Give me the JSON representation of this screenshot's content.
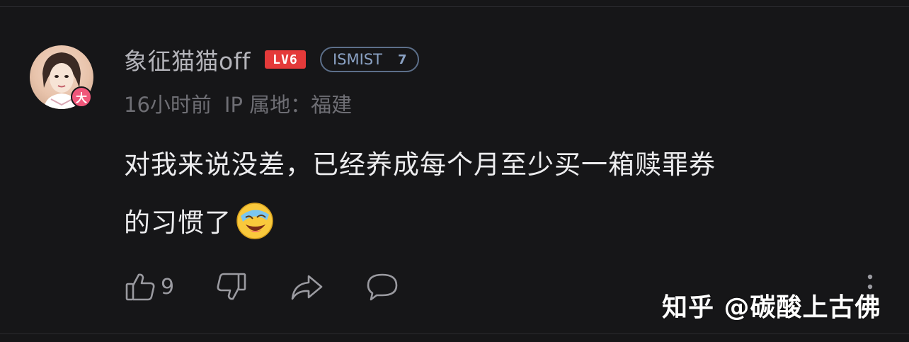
{
  "comment": {
    "author": {
      "name": "象征猫猫off",
      "level_label": "LV6",
      "group_label": "ISMIST",
      "group_count": "7",
      "vip_mark": "大"
    },
    "meta": {
      "time": "16小时前",
      "location": "IP 属地：福建"
    },
    "text_line1": "对我来说没差，已经养成每个月至少买一箱赎罪券",
    "text_line2": "的习惯了",
    "emoji": "laughing-crying-face",
    "likes": "9"
  },
  "watermark": "知乎 @碳酸上古佛",
  "colors": {
    "background": "#161618",
    "level_badge": "#e43a3a",
    "vip_badge": "#f0567a",
    "group_badge": "#8aa1c3"
  }
}
